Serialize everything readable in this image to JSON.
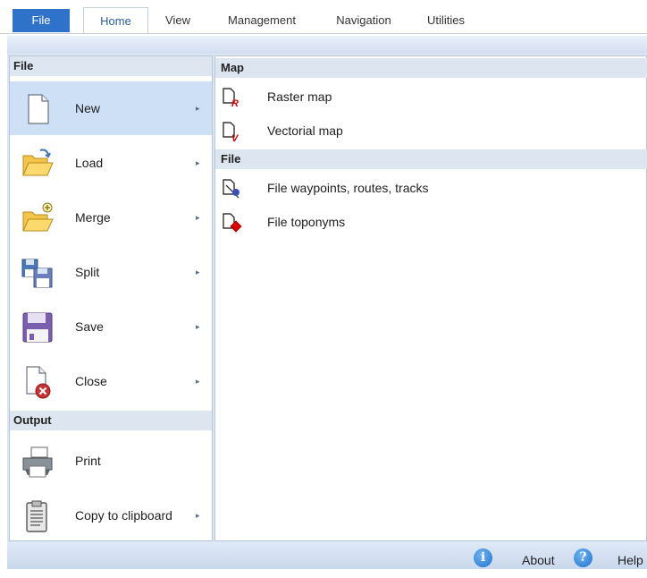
{
  "tabs": [
    {
      "label": "File"
    },
    {
      "label": "Home"
    },
    {
      "label": "View"
    },
    {
      "label": "Management"
    },
    {
      "label": "Navigation"
    },
    {
      "label": "Utilities"
    }
  ],
  "left_menu": {
    "file_header": "File",
    "output_header": "Output",
    "items": [
      {
        "label": "New",
        "icon": "new-document-icon",
        "has_submenu": true,
        "selected": true
      },
      {
        "label": "Load",
        "icon": "open-folder-icon",
        "has_submenu": true
      },
      {
        "label": "Merge",
        "icon": "merge-folder-icon",
        "has_submenu": true
      },
      {
        "label": "Split",
        "icon": "split-disk-icon",
        "has_submenu": true
      },
      {
        "label": "Save",
        "icon": "save-disk-icon",
        "has_submenu": true
      },
      {
        "label": "Close",
        "icon": "close-document-icon",
        "has_submenu": true
      }
    ],
    "output_items": [
      {
        "label": "Print",
        "icon": "printer-icon",
        "has_submenu": false
      },
      {
        "label": "Copy to clipboard",
        "icon": "clipboard-icon",
        "has_submenu": true
      }
    ],
    "arrow": "▸"
  },
  "submenu": {
    "map_header": "Map",
    "file_header": "File",
    "map_items": [
      {
        "label": "Raster map",
        "icon": "raster-map-icon",
        "badge": "R"
      },
      {
        "label": "Vectorial map",
        "icon": "vectorial-map-icon",
        "badge": "V"
      }
    ],
    "file_items": [
      {
        "label": "File waypoints, routes, tracks",
        "icon": "waypoints-file-icon"
      },
      {
        "label": "File toponyms",
        "icon": "toponyms-file-icon"
      }
    ]
  },
  "statusbar": {
    "about_label": "About",
    "about_glyph": "i",
    "help_label": "Help",
    "help_glyph": "?"
  },
  "colors": {
    "accent": "#2f72c9",
    "selected_row": "#cde0f6",
    "header_bg": "#dde6f0",
    "badge_red": "#e00000"
  }
}
